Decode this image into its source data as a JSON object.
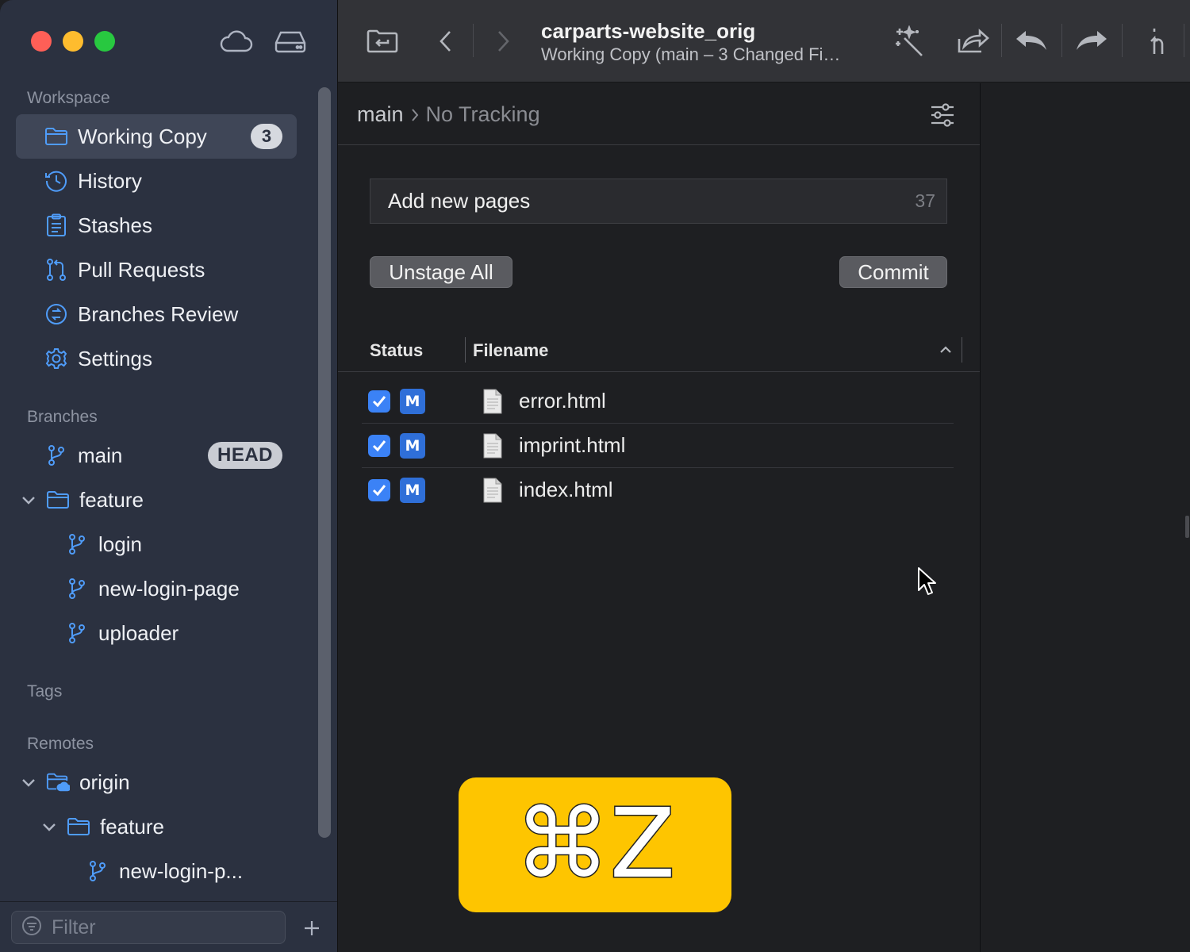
{
  "window": {
    "title": "carparts-website_orig",
    "subtitle": "Working Copy (main – 3 Changed Fi…"
  },
  "sidebar": {
    "workspace_title": "Workspace",
    "workspace_items": [
      {
        "label": "Working Copy",
        "icon": "folder-icon",
        "badge": "3",
        "selected": true
      },
      {
        "label": "History",
        "icon": "history-icon"
      },
      {
        "label": "Stashes",
        "icon": "clipboard-icon"
      },
      {
        "label": "Pull Requests",
        "icon": "pull-request-icon"
      },
      {
        "label": "Branches Review",
        "icon": "branches-review-icon"
      },
      {
        "label": "Settings",
        "icon": "gear-icon"
      }
    ],
    "branches_title": "Branches",
    "branches": [
      {
        "label": "main",
        "badge": "HEAD",
        "icon": "branch-icon"
      },
      {
        "label": "feature",
        "icon": "folder-icon",
        "expanded": true
      },
      {
        "label": "login",
        "icon": "branch-icon"
      },
      {
        "label": "new-login-page",
        "icon": "branch-icon"
      },
      {
        "label": "uploader",
        "icon": "branch-icon"
      }
    ],
    "tags_title": "Tags",
    "remotes_title": "Remotes",
    "remotes": [
      {
        "label": "origin",
        "icon": "cloud-folder-icon",
        "expanded": true
      },
      {
        "label": "feature",
        "icon": "folder-icon",
        "expanded": true
      },
      {
        "label": "new-login-p...",
        "icon": "branch-icon"
      }
    ],
    "filter_placeholder": "Filter"
  },
  "main": {
    "branch": "main",
    "tracking": "No Tracking",
    "commit_message": "Add new pages",
    "char_count": "37",
    "unstage_all_label": "Unstage All",
    "commit_label": "Commit",
    "columns": {
      "status": "Status",
      "filename": "Filename"
    },
    "files": [
      {
        "status": "M",
        "name": "error.html",
        "staged": true
      },
      {
        "status": "M",
        "name": "imprint.html",
        "staged": true
      },
      {
        "status": "M",
        "name": "index.html",
        "staged": true
      }
    ]
  },
  "shortcut_hint": "⌘Z",
  "colors": {
    "accent": "#4f9cf9",
    "checkbox": "#3b82f6",
    "status_badge": "#2f6fd8",
    "shortcut_bg": "#fec500",
    "sidebar_bg": "#2b3140"
  }
}
